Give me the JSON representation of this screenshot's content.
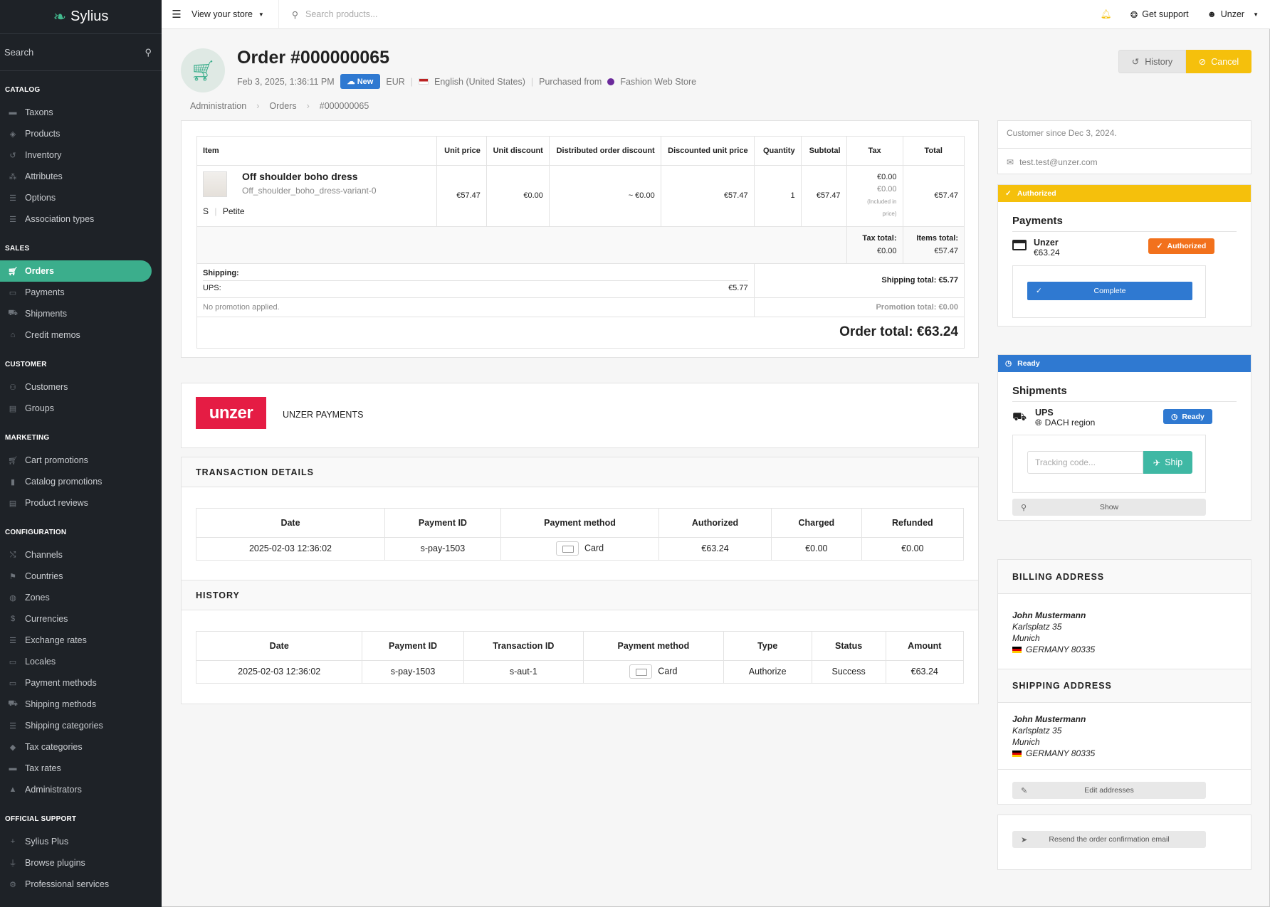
{
  "sidebar": {
    "logo": "Sylius",
    "search_label": "Search",
    "sections": [
      {
        "title": "CATALOG",
        "items": [
          {
            "label": "Taxons",
            "icon": "folder-icon"
          },
          {
            "label": "Products",
            "icon": "cube-icon"
          },
          {
            "label": "Inventory",
            "icon": "history-icon"
          },
          {
            "label": "Attributes",
            "icon": "cubes-icon"
          },
          {
            "label": "Options",
            "icon": "options-icon"
          },
          {
            "label": "Association types",
            "icon": "list-icon"
          }
        ]
      },
      {
        "title": "SALES",
        "items": [
          {
            "label": "Orders",
            "icon": "cart-icon",
            "active": true
          },
          {
            "label": "Payments",
            "icon": "payment-icon"
          },
          {
            "label": "Shipments",
            "icon": "truck-icon"
          },
          {
            "label": "Credit memos",
            "icon": "inbox-icon"
          }
        ]
      },
      {
        "title": "CUSTOMER",
        "items": [
          {
            "label": "Customers",
            "icon": "users-icon"
          },
          {
            "label": "Groups",
            "icon": "archive-icon"
          }
        ]
      },
      {
        "title": "MARKETING",
        "items": [
          {
            "label": "Cart promotions",
            "icon": "cart-icon"
          },
          {
            "label": "Catalog promotions",
            "icon": "bookmark-icon"
          },
          {
            "label": "Product reviews",
            "icon": "newspaper-icon"
          }
        ]
      },
      {
        "title": "CONFIGURATION",
        "items": [
          {
            "label": "Channels",
            "icon": "shuffle-icon"
          },
          {
            "label": "Countries",
            "icon": "flag-icon"
          },
          {
            "label": "Zones",
            "icon": "globe-icon"
          },
          {
            "label": "Currencies",
            "icon": "dollar-icon"
          },
          {
            "label": "Exchange rates",
            "icon": "sliders-icon"
          },
          {
            "label": "Locales",
            "icon": "language-icon"
          },
          {
            "label": "Payment methods",
            "icon": "payment-icon"
          },
          {
            "label": "Shipping methods",
            "icon": "truck-icon"
          },
          {
            "label": "Shipping categories",
            "icon": "list-icon"
          },
          {
            "label": "Tax categories",
            "icon": "tags-icon"
          },
          {
            "label": "Tax rates",
            "icon": "money-icon"
          },
          {
            "label": "Administrators",
            "icon": "lock-icon"
          }
        ]
      },
      {
        "title": "OFFICIAL SUPPORT",
        "items": [
          {
            "label": "Sylius Plus",
            "icon": "plus-icon"
          },
          {
            "label": "Browse plugins",
            "icon": "plug-icon"
          },
          {
            "label": "Professional services",
            "icon": "cog-icon"
          }
        ]
      }
    ]
  },
  "topbar": {
    "store_label": "View your store",
    "search_placeholder": "Search products...",
    "support_label": "Get support",
    "user_label": "Unzer"
  },
  "order": {
    "title": "Order #000000065",
    "date": "Feb 3, 2025, 1:36:11 PM",
    "state_badge": "New",
    "currency": "EUR",
    "locale": "English (United States)",
    "purchased_from_label": "Purchased from",
    "channel": "Fashion Web Store",
    "breadcrumb": [
      "Administration",
      "Orders",
      "#000000065"
    ],
    "history_button": "History",
    "cancel_button": "Cancel"
  },
  "items_table": {
    "headers": [
      "Item",
      "Unit price",
      "Unit discount",
      "Distributed order discount",
      "Discounted unit price",
      "Quantity",
      "Subtotal",
      "Tax",
      "Total"
    ],
    "row": {
      "name": "Off shoulder boho dress",
      "variant": "Off_shoulder_boho_dress-variant-0",
      "option1": "S",
      "option2": "Petite",
      "unit_price": "€57.47",
      "unit_discount": "€0.00",
      "distributed_discount": "~ €0.00",
      "discounted_unit_price": "€57.47",
      "quantity": "1",
      "subtotal": "€57.47",
      "tax_main": "€0.00",
      "tax_included": "€0.00",
      "tax_included_note_1": "(Included in",
      "tax_included_note_2": "price)",
      "total": "€57.47"
    },
    "tax_total_label": "Tax total:",
    "tax_total": "€0.00",
    "items_total_label": "Items total:",
    "items_total": "€57.47",
    "shipping_label": "Shipping:",
    "shipping_method": "UPS:",
    "shipping_amount": "€5.77",
    "shipping_total": "Shipping total: €5.77",
    "no_promotion": "No promotion applied.",
    "promotion_total": "Promotion total: €0.00",
    "order_total": "Order total: €63.24"
  },
  "unzer": {
    "logo_text": "unzer",
    "title": "UNZER PAYMENTS"
  },
  "transaction_details": {
    "title": "TRANSACTION DETAILS",
    "headers": [
      "Date",
      "Payment ID",
      "Payment method",
      "Authorized",
      "Charged",
      "Refunded"
    ],
    "row": [
      "2025-02-03 12:36:02",
      "s-pay-1503",
      "Card",
      "€63.24",
      "€0.00",
      "€0.00"
    ]
  },
  "history": {
    "title": "HISTORY",
    "headers": [
      "Date",
      "Payment ID",
      "Transaction ID",
      "Payment method",
      "Type",
      "Status",
      "Amount"
    ],
    "row": [
      "2025-02-03 12:36:02",
      "s-pay-1503",
      "s-aut-1",
      "Card",
      "Authorize",
      "Success",
      "€63.24"
    ]
  },
  "customer": {
    "since": "Customer since Dec 3, 2024.",
    "email": "test.test@unzer.com"
  },
  "payments": {
    "status_bar": "Authorized",
    "title": "Payments",
    "method": "Unzer",
    "amount": "€63.24",
    "badge": "Authorized",
    "complete_button": "Complete"
  },
  "shipments": {
    "status_bar": "Ready",
    "title": "Shipments",
    "method": "UPS",
    "zone": "DACH region",
    "badge": "Ready",
    "tracking_placeholder": "Tracking code...",
    "ship_button": "Ship",
    "show_button": "Show"
  },
  "billing": {
    "title": "BILLING ADDRESS",
    "name": "John Mustermann",
    "street": "Karlsplatz 35",
    "city": "Munich",
    "country": "GERMANY 80335"
  },
  "shipping_address": {
    "title": "SHIPPING ADDRESS",
    "name": "John Mustermann",
    "street": "Karlsplatz 35",
    "city": "Munich",
    "country": "GERMANY 80335"
  },
  "actions": {
    "edit_addresses": "Edit addresses",
    "resend_email": "Resend the order confirmation email"
  },
  "colors": {
    "brand_green": "#3bae8c",
    "authorized_yellow": "#f5c00c",
    "ready_blue": "#2f79d1",
    "authorized_orange": "#f2711c",
    "unzer_red": "#e51c44"
  }
}
